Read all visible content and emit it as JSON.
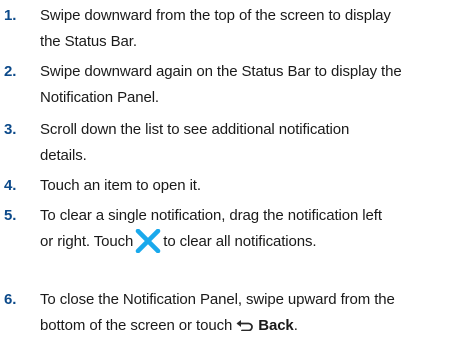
{
  "steps": [
    {
      "number": "1.",
      "lines": [
        "Swipe downward from the top of the screen to display",
        "the Status Bar."
      ]
    },
    {
      "number": "2.",
      "lines": [
        "Swipe downward again on the Status Bar to display the",
        "Notification Panel."
      ]
    },
    {
      "number": "3.",
      "lines": [
        "Scroll down the list to see additional notification",
        "details."
      ]
    },
    {
      "number": "4.",
      "lines": [
        "Touch an item to open it."
      ]
    },
    {
      "number": "5.",
      "line1": "To clear a single notification, drag the notification left",
      "line2_before": "or right. Touch",
      "line2_after": "to clear all notifications.",
      "icon": "clear-all-x-icon"
    },
    {
      "number": "6.",
      "line1": "To close the Notification Panel, swipe upward from the",
      "line2_before": "bottom of the screen or touch",
      "bold_word": "Back",
      "line2_after": ".",
      "icon": "back-arrow-icon"
    }
  ],
  "colors": {
    "number": "#0c4a8a",
    "text": "#1a1a1a",
    "x_icon": "#1aa9ec"
  }
}
